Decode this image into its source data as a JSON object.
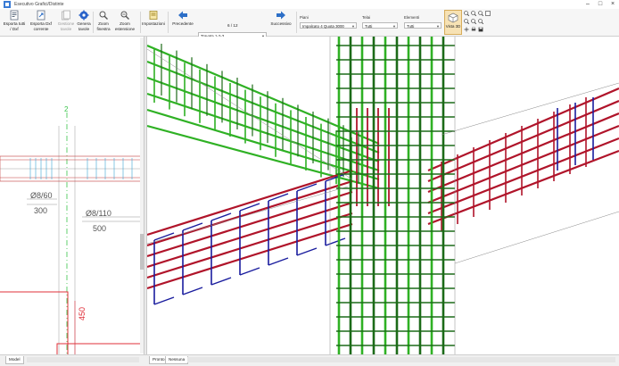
{
  "window": {
    "title": "Esecutivo Grafici/Distinte"
  },
  "ribbon": {
    "buttons": [
      {
        "label": "Esporta tutti / Dxf",
        "icon": "export-all-icon",
        "disabled": false
      },
      {
        "label": "Esporta Dxf corrente",
        "icon": "export-dxf-icon",
        "disabled": false
      },
      {
        "label": "Gestione tavole",
        "icon": "sheets-icon",
        "disabled": true
      },
      {
        "label": "Genera tavole",
        "icon": "generate-gear-icon",
        "disabled": false
      },
      {
        "label": "Zoom finestra",
        "icon": "zoom-window-icon",
        "disabled": false
      },
      {
        "label": "Zoom estensione",
        "icon": "zoom-extents-icon",
        "disabled": false
      },
      {
        "label": "Impostazioni",
        "icon": "settings-icon",
        "disabled": false
      }
    ],
    "nav": {
      "prev_label": "Precedente",
      "next_label": "Successivo",
      "counter": "6 / 12",
      "element_value": "Travata 1-2-3"
    },
    "filters": {
      "piani_label": "Piani",
      "piani_value": "Impalcato 4 Quota 3000",
      "telai_label": "Telai",
      "telai_value": "Tutti",
      "elementi_label": "Elementi",
      "elementi_value": "Tutti"
    },
    "vista3d_label": "Vista 3D"
  },
  "left_drawing": {
    "axis_label": "2",
    "texts": [
      "Ø8/60",
      "300",
      "Ø8/110",
      "500",
      "450"
    ]
  },
  "bottom": {
    "model_tab": "Model",
    "view_tabs": [
      "Pronto",
      "Nessuna"
    ]
  },
  "colors": {
    "green": "#2fb124",
    "green_dark": "#1c6b18",
    "red": "#b0142a",
    "blue": "#1a1d9e",
    "axis": "#39c44a",
    "dim_red": "#e0303a",
    "vista_bg": "#f7e2b4"
  }
}
